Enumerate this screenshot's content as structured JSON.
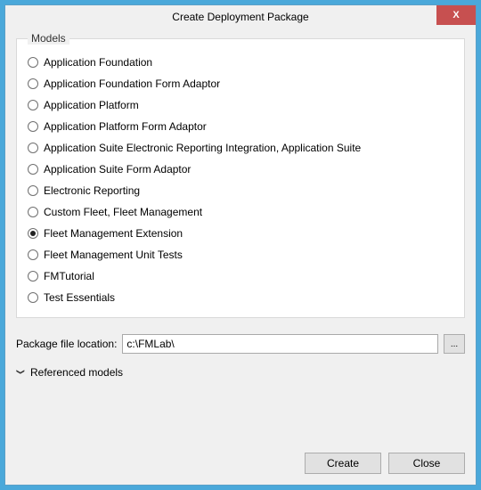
{
  "window": {
    "title": "Create Deployment Package"
  },
  "models": {
    "legend": "Models",
    "items": [
      {
        "label": "Application Foundation",
        "checked": false
      },
      {
        "label": "Application Foundation Form Adaptor",
        "checked": false
      },
      {
        "label": "Application Platform",
        "checked": false
      },
      {
        "label": "Application Platform Form Adaptor",
        "checked": false
      },
      {
        "label": "Application Suite Electronic Reporting Integration, Application Suite",
        "checked": false
      },
      {
        "label": "Application Suite Form Adaptor",
        "checked": false
      },
      {
        "label": "Electronic Reporting",
        "checked": false
      },
      {
        "label": "Custom Fleet, Fleet Management",
        "checked": false
      },
      {
        "label": "Fleet Management Extension",
        "checked": true
      },
      {
        "label": "Fleet Management Unit Tests",
        "checked": false
      },
      {
        "label": "FMTutorial",
        "checked": false
      },
      {
        "label": "Test Essentials",
        "checked": false
      }
    ]
  },
  "location": {
    "label": "Package file location:",
    "value": "c:\\FMLab\\",
    "browse": "..."
  },
  "referenced": {
    "label": "Referenced models"
  },
  "buttons": {
    "create": "Create",
    "close": "Close"
  }
}
